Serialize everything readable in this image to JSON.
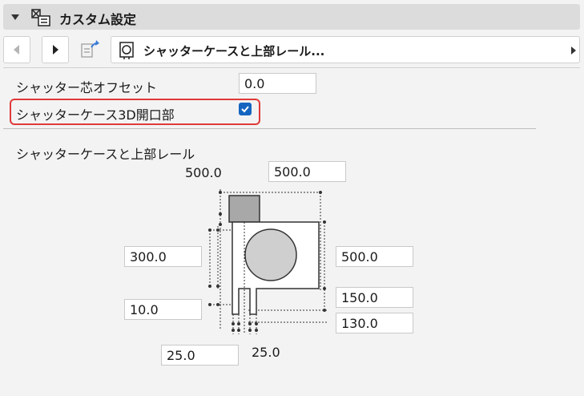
{
  "header": {
    "title": "カスタム設定"
  },
  "nav": {
    "selected_item": "シャッターケースと上部レール..."
  },
  "settings": {
    "offset_label": "シャッター芯オフセット",
    "offset_value": "0.0",
    "opening_label": "シャッターケース3D開口部",
    "opening_checked": true
  },
  "section": {
    "title": "シャッターケースと上部レール"
  },
  "dims": {
    "top_left": "500.0",
    "top_right": "500.0",
    "left_height": "300.0",
    "right_height": "500.0",
    "left_small": "10.0",
    "right_mid": "150.0",
    "right_low": "130.0",
    "bottom_left": "25.0",
    "bottom_right": "25.0"
  },
  "colors": {
    "accent": "#1565c0",
    "highlight": "#e03a3a"
  }
}
